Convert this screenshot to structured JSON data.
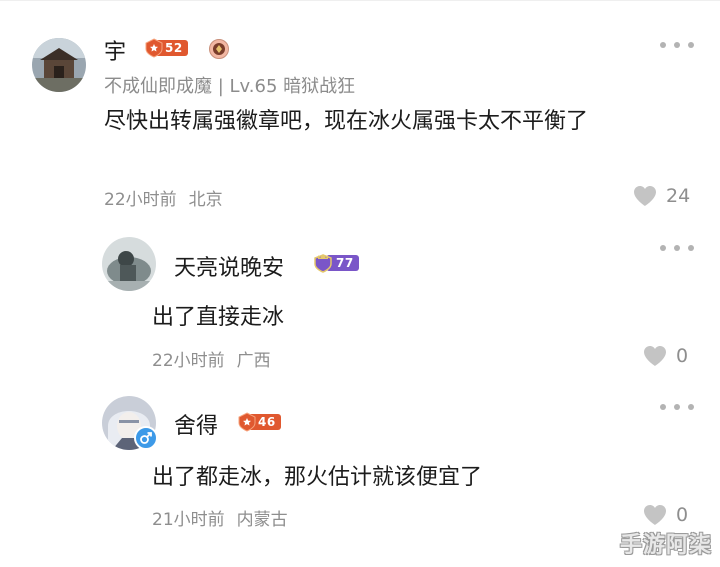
{
  "comments": [
    {
      "name": "宇",
      "level_badge": "52",
      "subtitle": "不成仙即成魔 | Lv.65 暗狱战狂",
      "text": "尽快出转属强徽章吧，现在冰火属强卡太不平衡了",
      "time": "22小时前",
      "location": "北京",
      "likes": "24"
    },
    {
      "name": "天亮说晚安",
      "level_badge": "77",
      "text": "出了直接走冰",
      "time": "22小时前",
      "location": "广西",
      "likes": "0"
    },
    {
      "name": "舍得",
      "level_badge": "46",
      "text": "出了都走冰，那火估计就该便宜了",
      "time": "21小时前",
      "location": "内蒙古",
      "likes": "0"
    }
  ],
  "watermark": "手游阿柒",
  "colors": {
    "badge_orange": "#e0582f",
    "badge_purple": "#7a56c8",
    "text_gray": "#8c8c8c",
    "icon_gray": "#c4c4c4"
  }
}
